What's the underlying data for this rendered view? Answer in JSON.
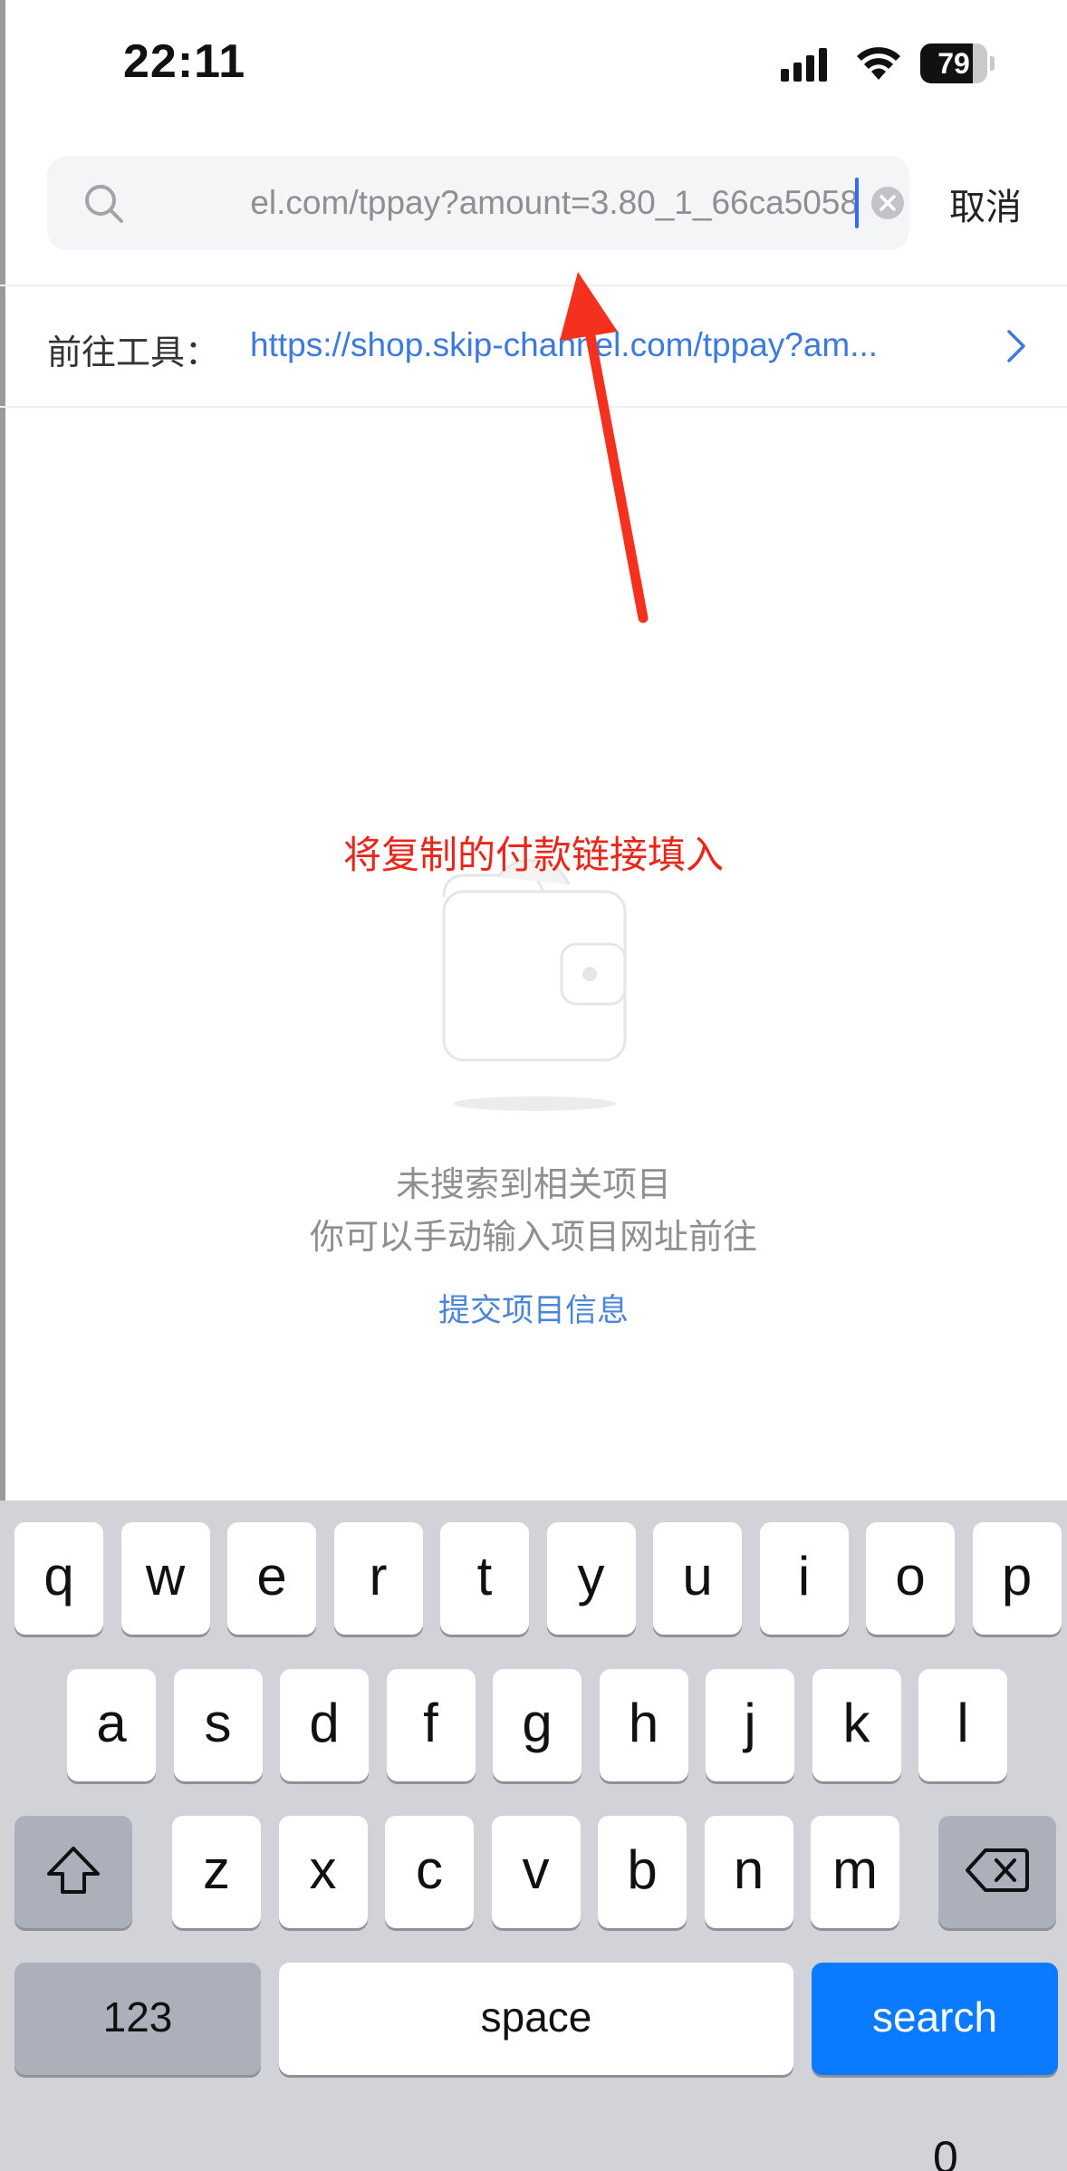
{
  "status_bar": {
    "time": "22:11",
    "battery_level": "79",
    "battery_fraction": 0.79
  },
  "search": {
    "value": "el.com/tppay?amount=3.80_1_66ca5058",
    "cancel_label": "取消"
  },
  "goto": {
    "label": "前往工具：",
    "link": "https://shop.skip-channel.com/tppay?am..."
  },
  "annotation": {
    "text": "将复制的付款链接填入",
    "color": "#e8261a"
  },
  "empty_state": {
    "line1": "未搜索到相关项目",
    "line2": "你可以手动输入项目网址前往",
    "submit_label": "提交项目信息"
  },
  "keyboard": {
    "row1": [
      "q",
      "w",
      "e",
      "r",
      "t",
      "y",
      "u",
      "i",
      "o",
      "p"
    ],
    "row2": [
      "a",
      "s",
      "d",
      "f",
      "g",
      "h",
      "j",
      "k",
      "l"
    ],
    "row3": [
      "z",
      "x",
      "c",
      "v",
      "b",
      "n",
      "m"
    ],
    "numbers_label": "123",
    "space_label": "space",
    "search_label": "search",
    "bottom_hint": "0"
  },
  "colors": {
    "link": "#3d7ae0",
    "search_key": "#0a7aff",
    "keyboard_bg": "#d1d3d9"
  }
}
